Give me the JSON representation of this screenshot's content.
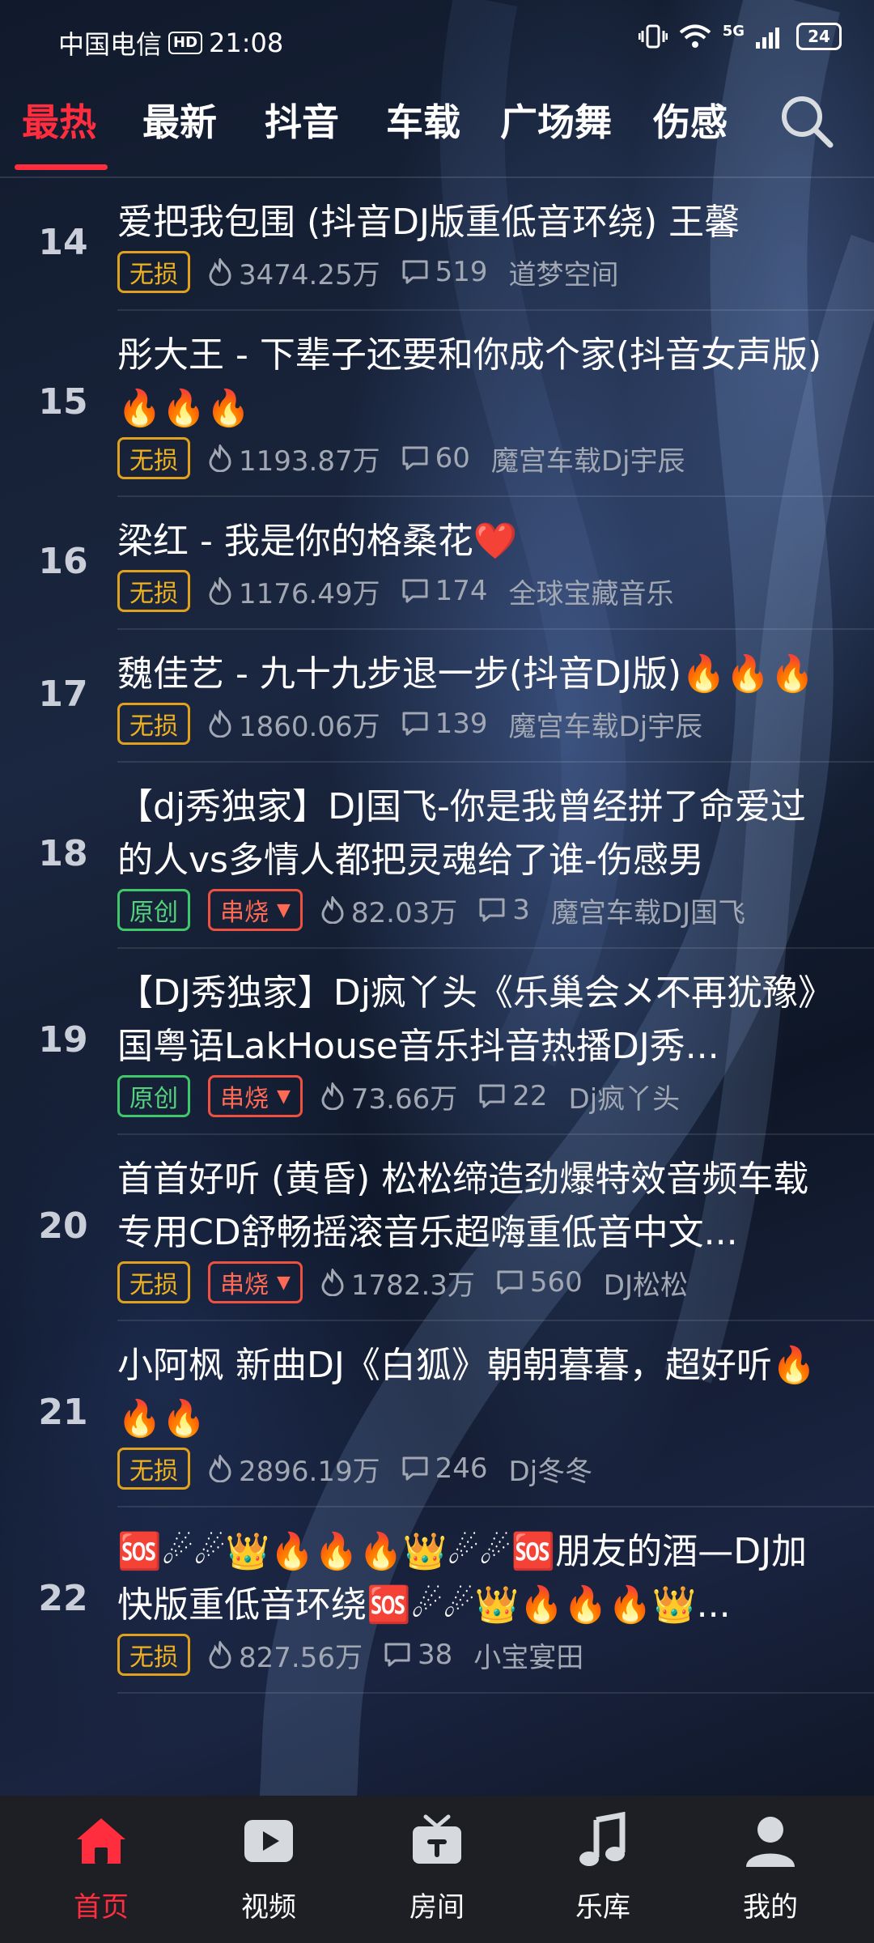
{
  "status_bar": {
    "carrier": "中国电信",
    "hd": "HD",
    "time": "21:08",
    "signal_badge": "5G",
    "battery": "24"
  },
  "tabs": [
    {
      "label": "最热",
      "active": true
    },
    {
      "label": "最新"
    },
    {
      "label": "抖音"
    },
    {
      "label": "车载"
    },
    {
      "label": "广场舞"
    },
    {
      "label": "伤感"
    }
  ],
  "tags": {
    "lossless": "无损",
    "original": "原创",
    "medley": "串烧"
  },
  "songs": [
    {
      "rank": "14",
      "title": "爱把我包围 (抖音DJ版重低音环绕) 王馨",
      "tags": [
        "lossless"
      ],
      "plays": "3474.25万",
      "comments": "519",
      "uploader": "道梦空间"
    },
    {
      "rank": "15",
      "title": "彤大王 - 下辈子还要和你成个家(抖音女声版)🔥🔥🔥",
      "tags": [
        "lossless"
      ],
      "plays": "1193.87万",
      "comments": "60",
      "uploader": "魔宫车载Dj宇辰"
    },
    {
      "rank": "16",
      "title": "梁红 - 我是你的格桑花❤️",
      "tags": [
        "lossless"
      ],
      "plays": "1176.49万",
      "comments": "174",
      "uploader": "全球宝藏音乐"
    },
    {
      "rank": "17",
      "title": "魏佳艺 - 九十九步退一步(抖音DJ版)🔥🔥🔥",
      "tags": [
        "lossless"
      ],
      "plays": "1860.06万",
      "comments": "139",
      "uploader": "魔宫车载Dj宇辰"
    },
    {
      "rank": "18",
      "title": "【dj秀独家】DJ国飞-你是我曾经拼了命爱过的人vs多情人都把灵魂给了谁-伤感男",
      "tags": [
        "original",
        "medley"
      ],
      "plays": "82.03万",
      "comments": "3",
      "uploader": "魔宫车载DJ国飞"
    },
    {
      "rank": "19",
      "title": "【DJ秀独家】Dj疯丫头《乐巢会メ不再犹豫》国粤语LakHouse音乐抖音热播DJ秀...",
      "tags": [
        "original",
        "medley"
      ],
      "plays": "73.66万",
      "comments": "22",
      "uploader": "Dj疯丫头"
    },
    {
      "rank": "20",
      "title": "首首好听 (黄昏) 松松缔造劲爆特效音频车载专用CD舒畅摇滚音乐超嗨重低音中文...",
      "tags": [
        "lossless",
        "medley"
      ],
      "plays": "1782.3万",
      "comments": "560",
      "uploader": "DJ松松"
    },
    {
      "rank": "21",
      "title": "小阿枫 新曲DJ《白狐》朝朝暮暮，超好听🔥🔥🔥",
      "tags": [
        "lossless"
      ],
      "plays": "2896.19万",
      "comments": "246",
      "uploader": "Dj冬冬"
    },
    {
      "rank": "22",
      "title": "🆘☄☄👑🔥🔥🔥👑☄☄🆘朋友的酒—DJ加快版重低音环绕🆘☄☄👑🔥🔥🔥👑...",
      "tags": [
        "lossless"
      ],
      "plays": "827.56万",
      "comments": "38",
      "uploader": "小宝宴田"
    }
  ],
  "bottom_nav": [
    {
      "label": "首页",
      "icon": "home-icon",
      "active": true
    },
    {
      "label": "视频",
      "icon": "video-icon"
    },
    {
      "label": "房间",
      "icon": "room-icon"
    },
    {
      "label": "乐库",
      "icon": "music-note-icon"
    },
    {
      "label": "我的",
      "icon": "profile-icon"
    }
  ],
  "colors": {
    "accent": "#ff2d3d",
    "lossless": "#f0b21e",
    "original": "#54d27c",
    "medley": "#ff6a55"
  }
}
